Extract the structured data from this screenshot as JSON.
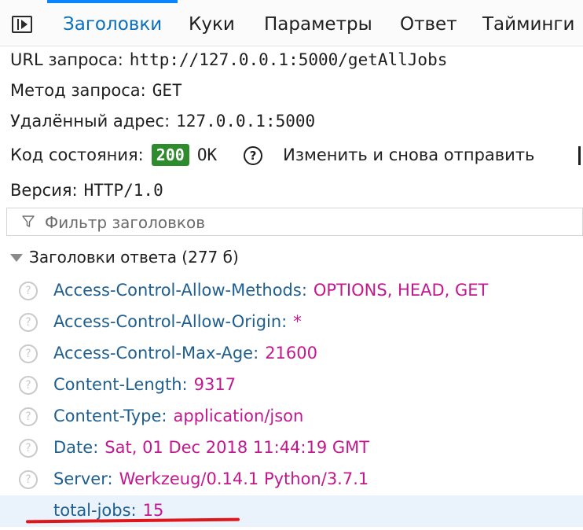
{
  "tabs": [
    {
      "label": "Заголовки",
      "active": true
    },
    {
      "label": "Куки",
      "active": false
    },
    {
      "label": "Параметры",
      "active": false
    },
    {
      "label": "Ответ",
      "active": false
    },
    {
      "label": "Тайминги",
      "active": false
    }
  ],
  "summary": {
    "url_label": "URL запроса:",
    "url_value": "http://127.0.0.1:5000/getAllJobs",
    "method_label": "Метод запроса:",
    "method_value": "GET",
    "remote_label": "Удалённый адрес:",
    "remote_value": "127.0.0.1:5000",
    "status_label": "Код состояния:",
    "status_code": "200",
    "status_text": "OK",
    "help_glyph": "?",
    "resend_label": "Изменить и снова отправить",
    "version_label": "Версия:",
    "version_value": "HTTP/1.0"
  },
  "filter": {
    "placeholder": "Фильтр заголовков"
  },
  "response_section": {
    "title": "Заголовки ответа (277 б)"
  },
  "headers": [
    {
      "name": "Access-Control-Allow-Methods:",
      "value": "OPTIONS, HEAD, GET"
    },
    {
      "name": "Access-Control-Allow-Origin:",
      "value": "*"
    },
    {
      "name": "Access-Control-Max-Age:",
      "value": "21600"
    },
    {
      "name": "Content-Length:",
      "value": "9317"
    },
    {
      "name": "Content-Type:",
      "value": "application/json"
    },
    {
      "name": "Date:",
      "value": "Sat, 01 Dec 2018 11:44:19 GMT"
    },
    {
      "name": "Server:",
      "value": "Werkzeug/0.14.1 Python/3.7.1"
    },
    {
      "name": "total-jobs:",
      "value": "15"
    }
  ],
  "icons": {
    "panel_toggle": "panel-toggle-icon",
    "filter": "funnel-icon",
    "help": "help-circle-icon",
    "header_info": "question-circle-icon",
    "expand": "chevron-down-icon"
  },
  "colors": {
    "accent": "#0a84ff",
    "status_badge": "#2e8b2e",
    "header_name": "#1f5f8f",
    "header_value": "#c2188f",
    "highlight_row": "#eaf2fb",
    "annotation_underline": "#e0161b"
  }
}
